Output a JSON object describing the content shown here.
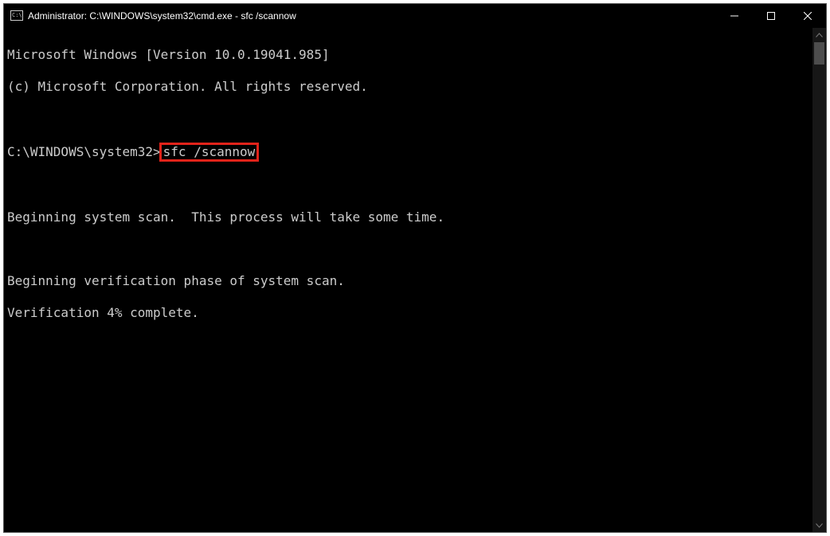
{
  "titlebar": {
    "title": "Administrator: C:\\WINDOWS\\system32\\cmd.exe - sfc  /scannow"
  },
  "console": {
    "line_version": "Microsoft Windows [Version 10.0.19041.985]",
    "line_copyright": "(c) Microsoft Corporation. All rights reserved.",
    "prompt_prefix": "C:\\WINDOWS\\system32>",
    "command_text": "sfc /scannow",
    "line_beginscan": "Beginning system scan.  This process will take some time.",
    "line_beginverify": "Beginning verification phase of system scan.",
    "line_verifyprogress": "Verification 4% complete."
  },
  "highlight": {
    "color": "#e2231a"
  }
}
